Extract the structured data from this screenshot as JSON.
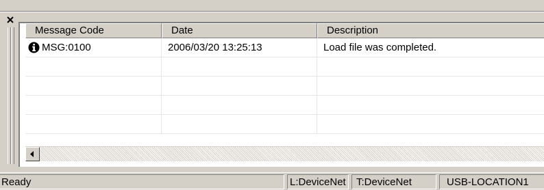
{
  "window": {
    "close_icon": "close-icon"
  },
  "list": {
    "columns": [
      {
        "label": "Message Code"
      },
      {
        "label": "Date"
      },
      {
        "label": "Description"
      }
    ],
    "rows": [
      {
        "icon": "info-icon",
        "code": "MSG:0100",
        "date": "2006/03/20 13:25:13",
        "description": "Load file was completed."
      }
    ]
  },
  "scrollbar": {
    "left_arrow_icon": "scroll-left-arrow-icon"
  },
  "status": {
    "ready": "Ready",
    "local": "L:DeviceNet",
    "target": "T:DeviceNet",
    "location": "USB-LOCATION1"
  },
  "colors": {
    "chrome": "#d4d0c8",
    "list_background": "#ffffff",
    "grid_line": "#e6e6e6"
  }
}
